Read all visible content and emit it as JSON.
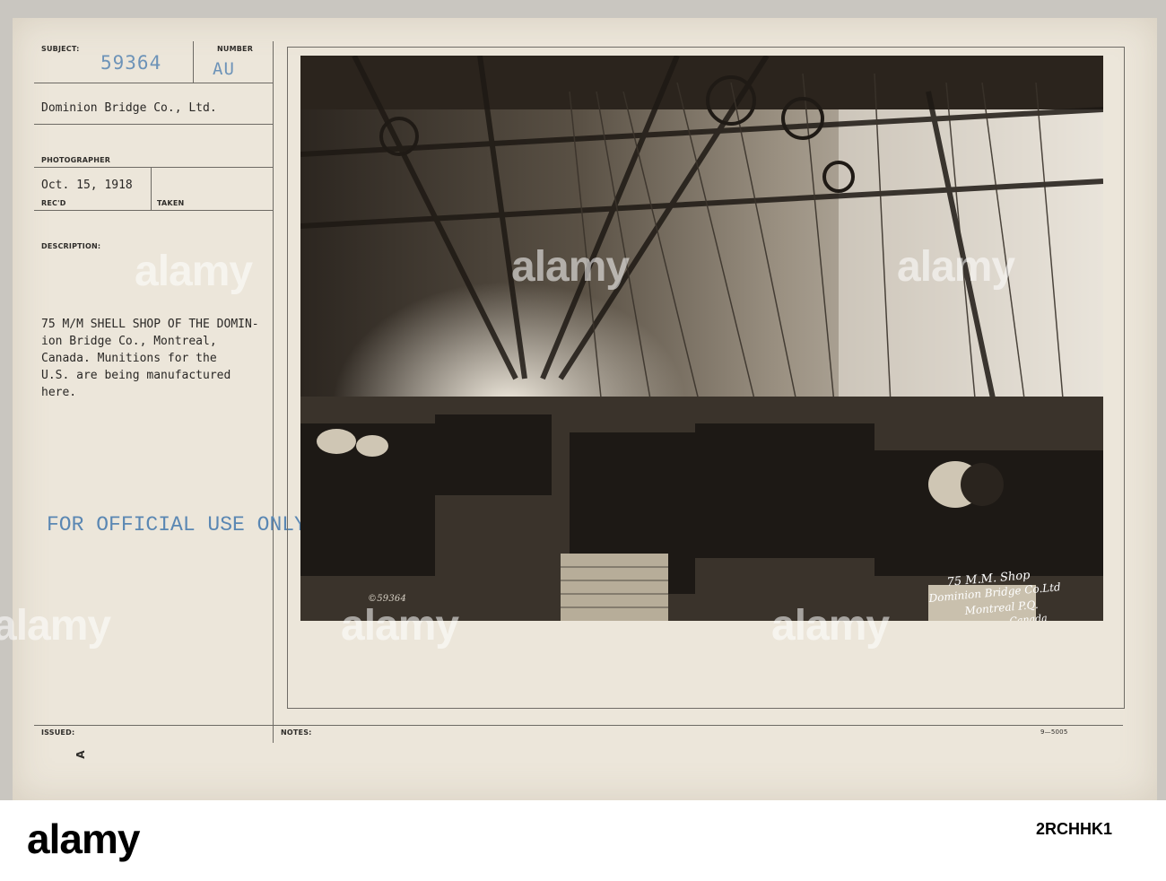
{
  "form": {
    "subject_label": "SUBJECT:",
    "subject_number": "59364",
    "number_label": "NUMBER",
    "number_value": "AU",
    "company": "Dominion Bridge Co., Ltd.",
    "photographer_label": "PHOTOGRAPHER",
    "date": "Oct. 15, 1918",
    "recd_label": "REC'D",
    "taken_label": "TAKEN",
    "description_label": "DESCRIPTION:",
    "description_lines": [
      "75 M/M SHELL SHOP OF THE DOMIN-",
      "ion Bridge Co., Montreal,",
      "Canada. Munitions for the",
      "U.S. are being manufactured",
      "here."
    ],
    "stamp": "FOR OFFICIAL USE ONLY",
    "issued_label": "ISSUED:",
    "issued_mark": "A",
    "notes_label": "NOTES:",
    "form_code": "9—5005"
  },
  "photo": {
    "negative_number": "©59364",
    "caption_lines": [
      "75 M.M. Shop",
      "Dominion Bridge Co.Ltd",
      "Montreal P.Q.",
      "Canada"
    ]
  },
  "watermark": {
    "brand": "alamy",
    "image_id": "2RCHHK1"
  },
  "colors": {
    "paper": "#ece6da",
    "stamp_blue": "#5a87b3",
    "footer_bg": "#ffffff"
  }
}
